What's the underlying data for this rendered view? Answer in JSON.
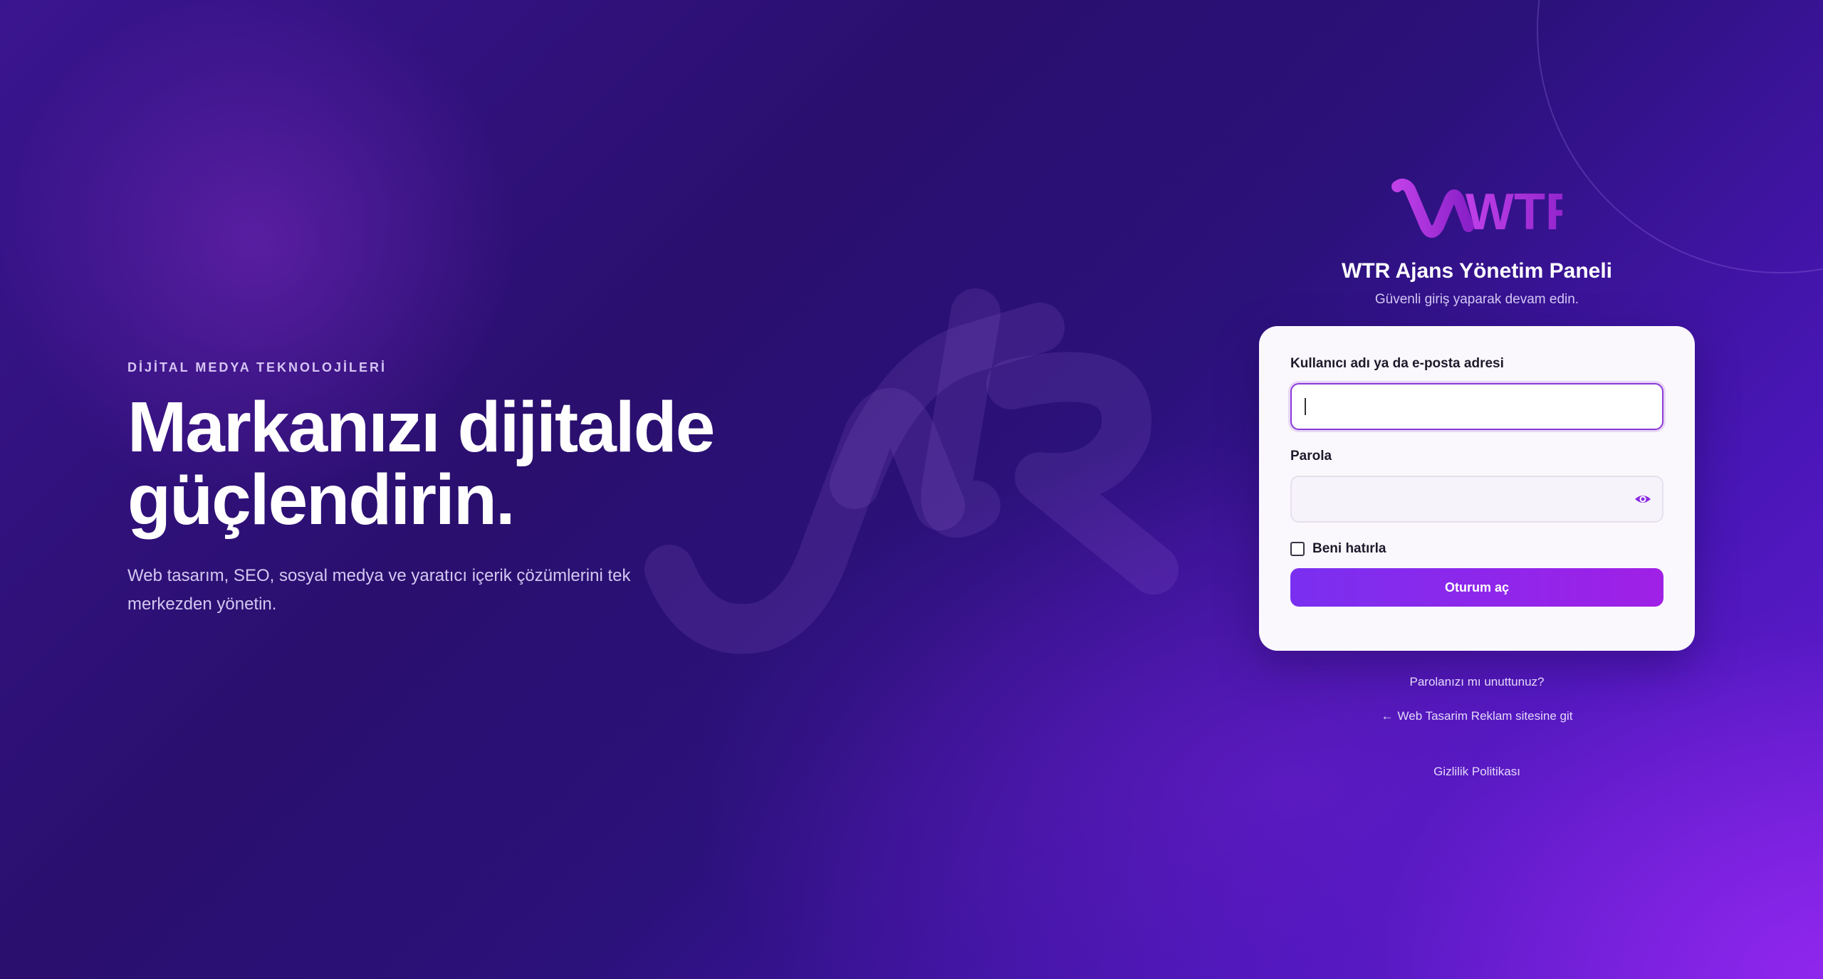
{
  "hero": {
    "eyebrow": "DİJİTAL MEDYA TEKNOLOJİLERİ",
    "headline": "Markanızı dijitalde güçlendirin.",
    "subtitle": "Web tasarım, SEO, sosyal medya ve yaratıcı içerik çözümlerini tek merkezden yönetin."
  },
  "brand": {
    "logo_text": "WTR",
    "watermark_text": "WTR",
    "panel_title": "WTR Ajans Yönetim Paneli",
    "panel_subtitle": "Güvenli giriş yaparak devam edin."
  },
  "form": {
    "username_label": "Kullanıcı adı ya da e-posta adresi",
    "username_value": "",
    "password_label": "Parola",
    "password_value": "",
    "remember_label": "Beni hatırla",
    "remember_checked": false,
    "submit_label": "Oturum aç"
  },
  "links": {
    "forgot": "Parolanızı mı unuttunuz?",
    "back_arrow": "←",
    "back": "Web Tasarim Reklam sitesine git",
    "privacy": "Gizlilik Politikası"
  },
  "colors": {
    "accent": "#8a2be2",
    "button_start": "#7a2ff0",
    "button_end": "#a020e6",
    "background_dark": "#2a0f6e"
  },
  "icons": {
    "password_toggle": "eye-icon"
  }
}
